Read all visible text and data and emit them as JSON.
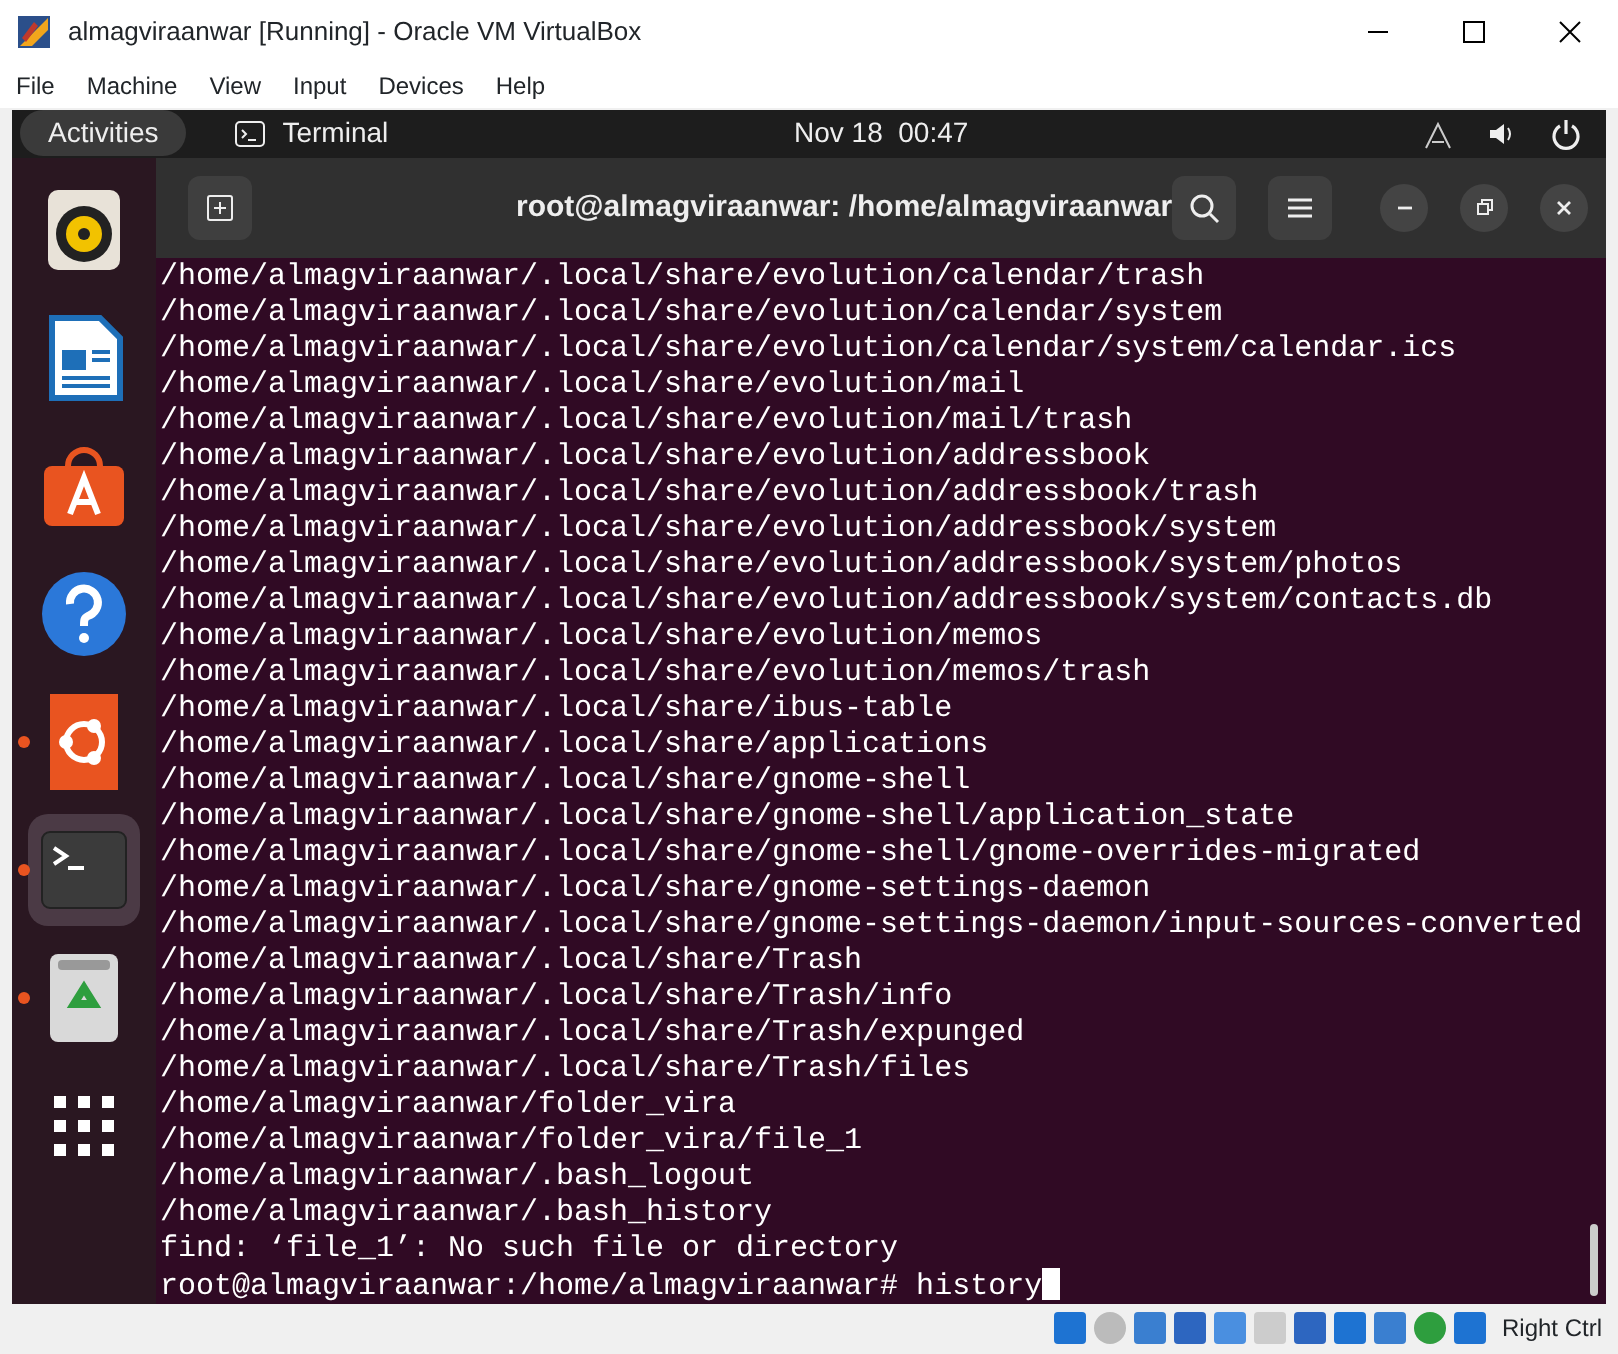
{
  "window": {
    "title": "almagviraanwar [Running] - Oracle VM VirtualBox"
  },
  "menu": [
    "File",
    "Machine",
    "View",
    "Input",
    "Devices",
    "Help"
  ],
  "top_bar": {
    "activities": "Activities",
    "app": "Terminal",
    "clock": "Nov 18  00:47"
  },
  "dock": [
    {
      "kind": "music",
      "running": false,
      "selected": false
    },
    {
      "kind": "writer",
      "running": false,
      "selected": false
    },
    {
      "kind": "software",
      "running": false,
      "selected": false
    },
    {
      "kind": "help",
      "running": false,
      "selected": false
    },
    {
      "kind": "ubuntu",
      "running": true,
      "selected": false
    },
    {
      "kind": "terminal",
      "running": true,
      "selected": true
    },
    {
      "kind": "trash",
      "running": true,
      "selected": false
    },
    {
      "kind": "apps",
      "running": false,
      "selected": false
    }
  ],
  "terminal": {
    "title": "root@almagviraanwar: /home/almagviraanwar",
    "lines": [
      "/home/almagviraanwar/.local/share/evolution/calendar/trash",
      "/home/almagviraanwar/.local/share/evolution/calendar/system",
      "/home/almagviraanwar/.local/share/evolution/calendar/system/calendar.ics",
      "/home/almagviraanwar/.local/share/evolution/mail",
      "/home/almagviraanwar/.local/share/evolution/mail/trash",
      "/home/almagviraanwar/.local/share/evolution/addressbook",
      "/home/almagviraanwar/.local/share/evolution/addressbook/trash",
      "/home/almagviraanwar/.local/share/evolution/addressbook/system",
      "/home/almagviraanwar/.local/share/evolution/addressbook/system/photos",
      "/home/almagviraanwar/.local/share/evolution/addressbook/system/contacts.db",
      "/home/almagviraanwar/.local/share/evolution/memos",
      "/home/almagviraanwar/.local/share/evolution/memos/trash",
      "/home/almagviraanwar/.local/share/ibus-table",
      "/home/almagviraanwar/.local/share/applications",
      "/home/almagviraanwar/.local/share/gnome-shell",
      "/home/almagviraanwar/.local/share/gnome-shell/application_state",
      "/home/almagviraanwar/.local/share/gnome-shell/gnome-overrides-migrated",
      "/home/almagviraanwar/.local/share/gnome-settings-daemon",
      "/home/almagviraanwar/.local/share/gnome-settings-daemon/input-sources-converted",
      "/home/almagviraanwar/.local/share/Trash",
      "/home/almagviraanwar/.local/share/Trash/info",
      "/home/almagviraanwar/.local/share/Trash/expunged",
      "/home/almagviraanwar/.local/share/Trash/files",
      "/home/almagviraanwar/folder_vira",
      "/home/almagviraanwar/folder_vira/file_1",
      "/home/almagviraanwar/.bash_logout",
      "/home/almagviraanwar/.bash_history",
      "find: ‘file_1’: No such file or directory"
    ],
    "prompt": "root@almagviraanwar:/home/almagviraanwar# history"
  },
  "status_bar": {
    "host_key": "Right Ctrl"
  }
}
